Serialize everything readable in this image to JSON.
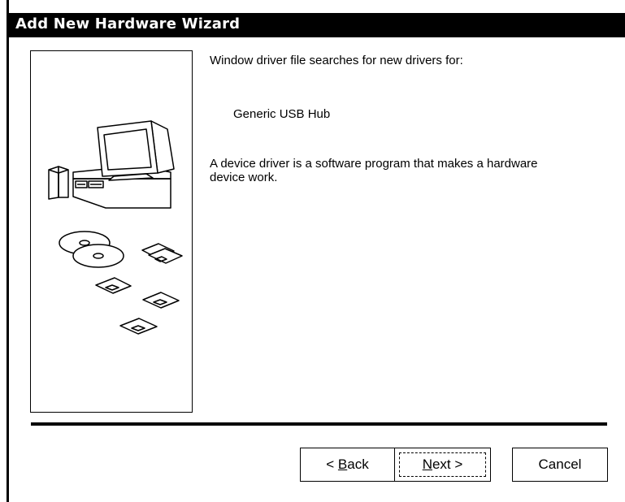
{
  "window": {
    "title": "Add New Hardware Wizard"
  },
  "content": {
    "intro": "Window driver file searches for new drivers for:",
    "device_name": "Generic USB Hub",
    "description": "A device driver is a software program that makes a hardware device work."
  },
  "buttons": {
    "back_prefix": "< ",
    "back_mnemonic": "B",
    "back_rest": "ack",
    "next_mnemonic": "N",
    "next_rest": "ext >",
    "cancel": "Cancel"
  },
  "illustration": {
    "icons": [
      "computer-icon",
      "cd-disc-icon",
      "floppy-disk-icon"
    ]
  }
}
